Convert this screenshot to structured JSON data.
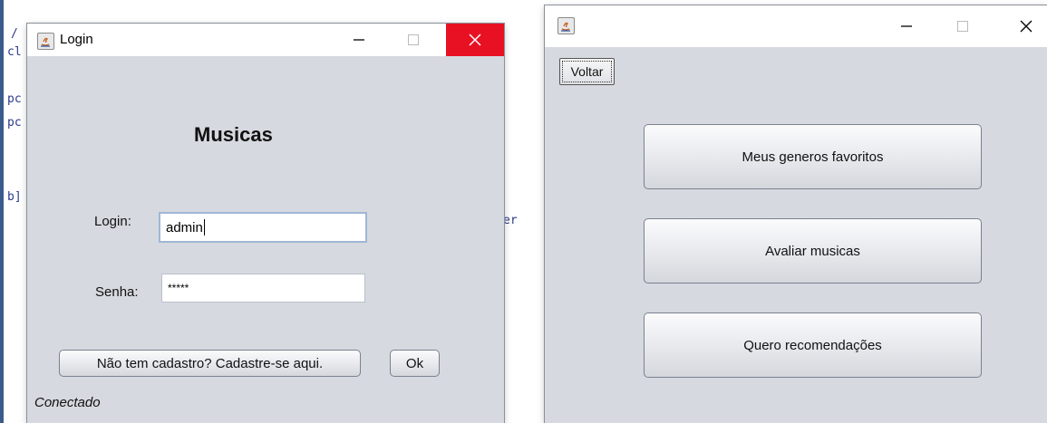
{
  "login_window": {
    "title": "Login",
    "heading": "Musicas",
    "login_label": "Login:",
    "login_value": "admin",
    "password_label": "Senha:",
    "password_value": "*****",
    "register_button": "Não tem cadastro? Cadastre-se aqui.",
    "ok_button": "Ok",
    "status": "Conectado"
  },
  "menu_window": {
    "title": "",
    "back_button": "Voltar",
    "buttons": [
      "Meus generos favoritos",
      "Avaliar musicas",
      "Quero recomendações"
    ]
  },
  "title_bar_icons": {
    "minimize": "minimize-icon",
    "maximize": "maximize-icon",
    "close": "close-icon"
  },
  "colors": {
    "close_active": "#e81123",
    "window_bg": "#d6d9df"
  }
}
